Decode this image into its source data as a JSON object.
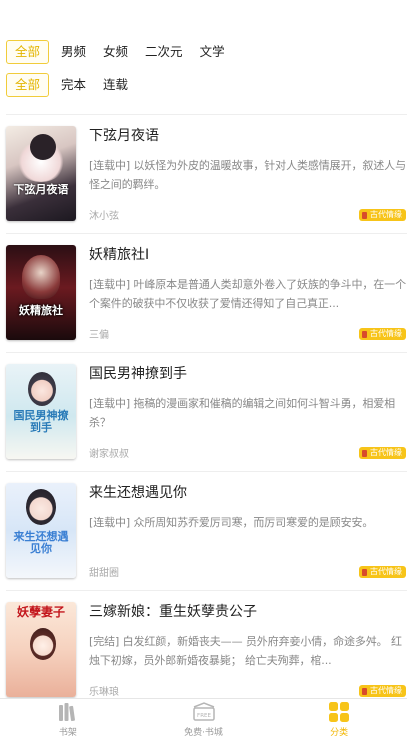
{
  "filters": {
    "category": [
      "全部",
      "男频",
      "女频",
      "二次元",
      "文学"
    ],
    "status": [
      "全部",
      "完本",
      "连载"
    ]
  },
  "books": [
    {
      "title": "下弦月夜语",
      "desc": "[连载中] 以妖怪为外皮的温暖故事，针对人类感情展开，叙述人与怪之间的羁绊。",
      "author": "沐小弦",
      "tag": "古代情缘",
      "cover_text": "下弦月夜语"
    },
    {
      "title": "妖精旅社I",
      "desc": "[连载中] 叶峰原本是普通人类却意外卷入了妖族的争斗中，在一个个案件的破获中不仅收获了爱情还得知了自己真正...",
      "author": "三偏",
      "tag": "古代情缘",
      "cover_text": "妖精旅社"
    },
    {
      "title": "国民男神撩到手",
      "desc": "[连载中] 拖稿的漫画家和催稿的编辑之间如何斗智斗勇，相爱相杀？",
      "author": "谢家叔叔",
      "tag": "古代情缘",
      "cover_text": "国民男神撩到手"
    },
    {
      "title": "来生还想遇见你",
      "desc": "[连载中] 众所周知苏乔爱厉司寒，而厉司寒爱的是顾安安。",
      "author": "甜甜圈",
      "tag": "古代情缘",
      "cover_text": "来生还想遇见你"
    },
    {
      "title": "三嫁新娘：重生妖孽贵公子",
      "desc": "[完结] 白发红颜，新婚丧夫—— 员外府弃妾小倩，命途多舛。 红烛下初嫁，员外郎新婚夜暴毙； 给亡夫殉葬，棺...",
      "author": "乐琳琅",
      "tag": "古代情缘",
      "cover_text": "妖孽妻子"
    }
  ],
  "tabbar": {
    "shelf": "书架",
    "free": "免费·书城",
    "free_badge": "FREE",
    "category": "分类"
  },
  "colors": {
    "accent": "#f7c419",
    "active_text": "#e3b500"
  },
  "icons": [
    "bookshelf-icon",
    "store-icon",
    "category-grid-icon",
    "bookmark-icon"
  ]
}
